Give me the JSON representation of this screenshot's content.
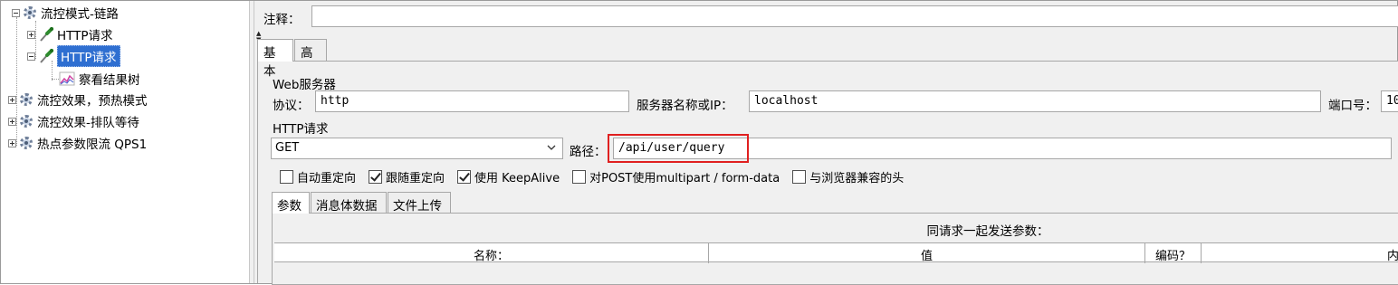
{
  "tree": {
    "items": [
      {
        "label": "流控模式-链路",
        "icon": "thread-group-gear-icon"
      },
      {
        "label": "HTTP请求",
        "icon": "http-sampler-pipette-icon"
      },
      {
        "label": "HTTP请求",
        "icon": "http-sampler-pipette-icon",
        "selected": true
      },
      {
        "label": "察看结果树",
        "icon": "results-tree-chart-icon"
      },
      {
        "label": "流控效果，预热模式",
        "icon": "thread-group-gear-icon"
      },
      {
        "label": "流控效果-排队等待",
        "icon": "thread-group-gear-icon"
      },
      {
        "label": "热点参数限流 QPS1",
        "icon": "thread-group-gear-icon"
      }
    ]
  },
  "comment": {
    "label": "注释：",
    "value": ""
  },
  "tabs": [
    {
      "label": "基本",
      "active": true
    },
    {
      "label": "高级",
      "active": false
    }
  ],
  "web_server": {
    "title": "Web服务器",
    "protocol_label": "协议：",
    "protocol_value": "http",
    "server_label": "服务器名称或IP：",
    "server_value": "localhost",
    "port_label": "端口号：",
    "port_value": "10"
  },
  "http_request": {
    "title": "HTTP请求",
    "method": "GET",
    "path_label": "路径：",
    "path_value": "/api/user/query",
    "highlight_color": "#e02020"
  },
  "options": [
    {
      "label": "自动重定向",
      "checked": false
    },
    {
      "label": "跟随重定向",
      "checked": true
    },
    {
      "label": "使用 KeepAlive",
      "checked": true
    },
    {
      "label": "对POST使用multipart / form-data",
      "checked": false
    },
    {
      "label": "与浏览器兼容的头",
      "checked": false
    }
  ],
  "subtabs": [
    {
      "label": "参数",
      "active": true
    },
    {
      "label": "消息体数据",
      "active": false
    },
    {
      "label": "文件上传",
      "active": false
    }
  ],
  "params": {
    "caption": "同请求一起发送参数：",
    "columns": [
      "名称：",
      "值",
      "编码？",
      "内"
    ]
  },
  "colors": {
    "selection": "#2f6fd1",
    "panel": "#f0f0f0"
  }
}
